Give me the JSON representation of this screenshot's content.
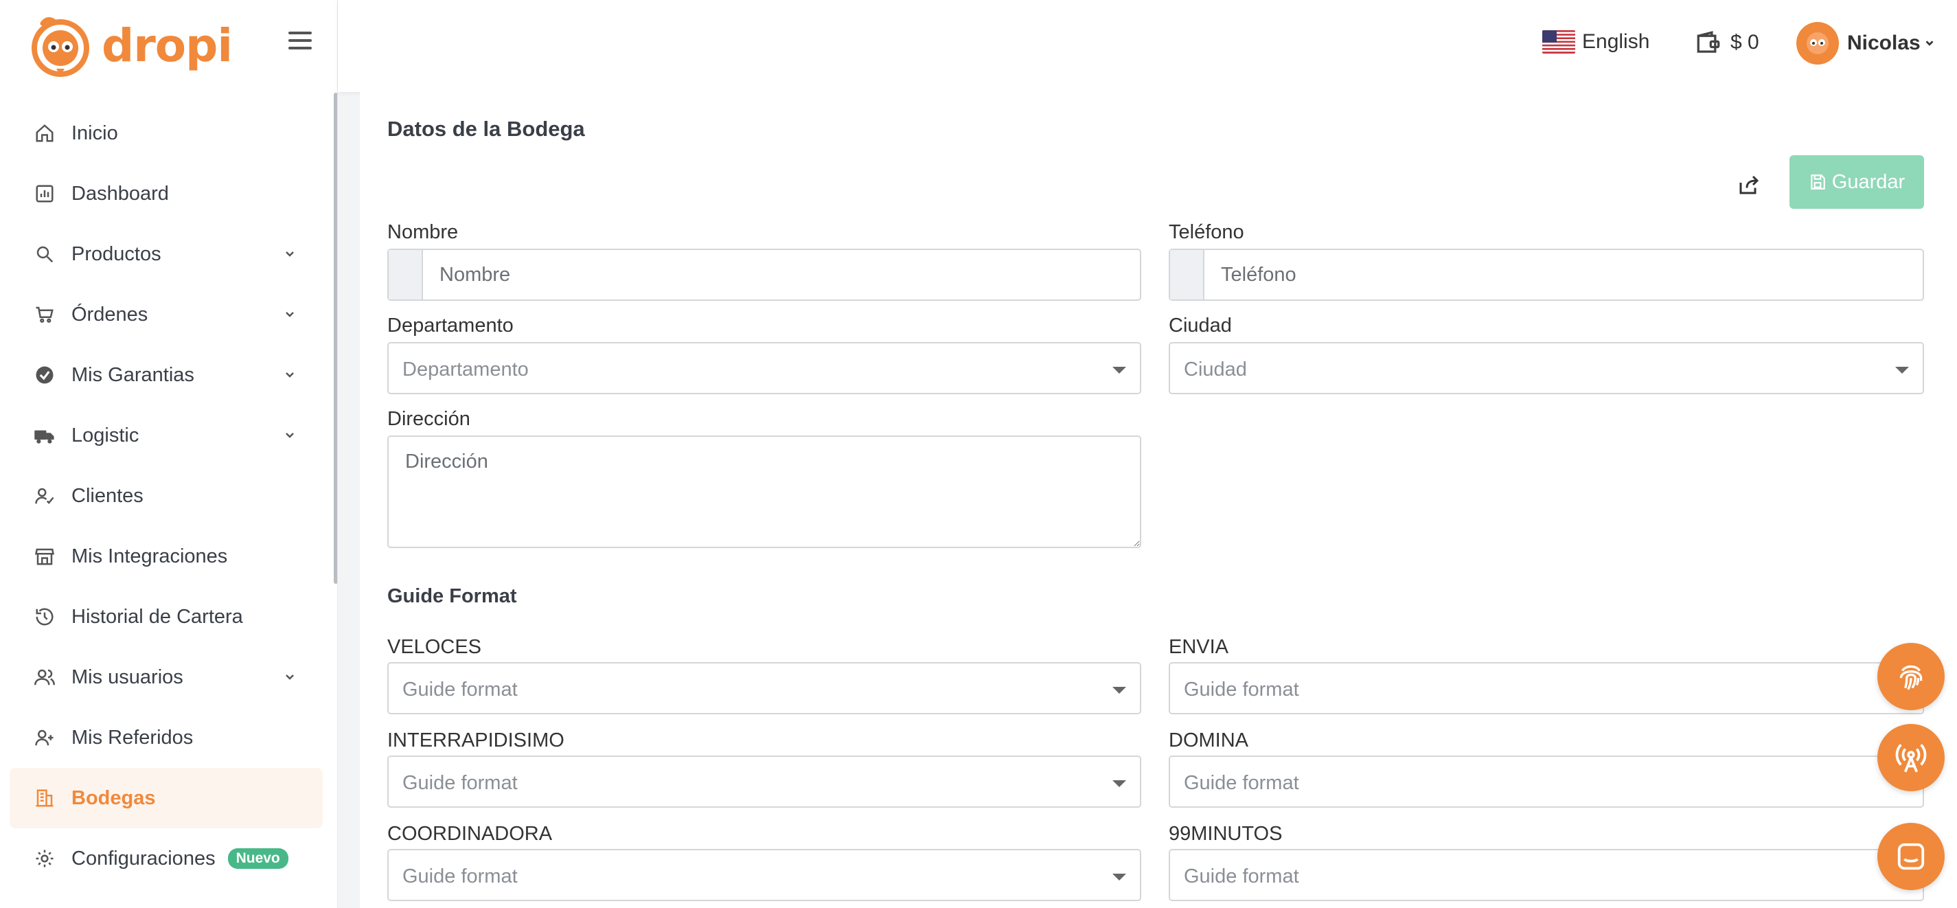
{
  "app": {
    "logo_text": "dropi",
    "accent_color": "#f0893b",
    "success_color": "#8fd8b8"
  },
  "header": {
    "language": "English",
    "wallet": "$ 0",
    "user_name": "Nicolas"
  },
  "sidebar": {
    "items": [
      {
        "label": "Inicio",
        "icon": "home-icon"
      },
      {
        "label": "Dashboard",
        "icon": "chart-icon"
      },
      {
        "label": "Productos",
        "icon": "search-icon"
      },
      {
        "label": "Órdenes",
        "icon": "cart-icon"
      },
      {
        "label": "Mis Garantias",
        "icon": "shield-check-icon"
      },
      {
        "label": "Logistic",
        "icon": "truck-icon"
      },
      {
        "label": "Clientes",
        "icon": "user-check-icon"
      },
      {
        "label": "Mis Integraciones",
        "icon": "store-icon"
      },
      {
        "label": "Historial de Cartera",
        "icon": "history-icon"
      },
      {
        "label": "Mis usuarios",
        "icon": "users-icon"
      },
      {
        "label": "Mis Referidos",
        "icon": "user-plus-icon"
      },
      {
        "label": "Bodegas",
        "icon": "building-icon"
      },
      {
        "label": "Configuraciones",
        "icon": "gear-icon",
        "badge": "Nuevo"
      }
    ]
  },
  "form": {
    "title": "Datos de la Bodega",
    "save_label": "Guardar",
    "nombre": {
      "label": "Nombre",
      "placeholder": "Nombre"
    },
    "telefono": {
      "label": "Teléfono",
      "placeholder": "Teléfono"
    },
    "departamento": {
      "label": "Departamento",
      "placeholder": "Departamento"
    },
    "ciudad": {
      "label": "Ciudad",
      "placeholder": "Ciudad"
    },
    "direccion": {
      "label": "Dirección",
      "placeholder": "Dirección"
    }
  },
  "guide_format": {
    "title": "Guide Format",
    "placeholder": "Guide format",
    "carriers": [
      "VELOCES",
      "ENVIA",
      "INTERRAPIDISIMO",
      "DOMINA",
      "COORDINADORA",
      "99MINUTOS"
    ]
  }
}
